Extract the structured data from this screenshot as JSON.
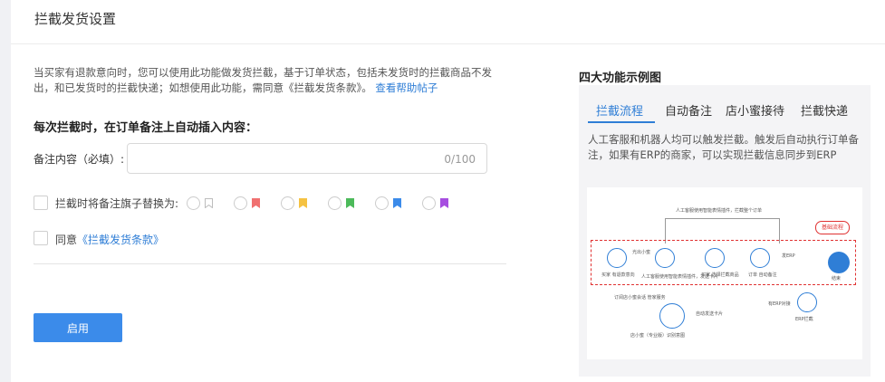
{
  "page_title": "拦截发货设置",
  "description": {
    "text": "当买家有退款意向时，您可以使用此功能做发货拦截，基于订单状态，包括未发货时的拦截商品不发出，和已发货时的拦截快递；如想使用此功能，需同意《拦截发货条款》。",
    "help_link": "查看帮助帖子"
  },
  "section_title": "每次拦截时，在订单备注上自动插入内容：",
  "remark_field": {
    "label": "备注内容（必填）:",
    "value": "",
    "placeholder": "",
    "counter": "0/100"
  },
  "flag_option": {
    "label": "拦截时将备注旗子替换为:",
    "flags": [
      {
        "name": "gray-flag",
        "color": "#c0c0c0"
      },
      {
        "name": "red-flag",
        "color": "#f07070"
      },
      {
        "name": "yellow-flag",
        "color": "#f5c242"
      },
      {
        "name": "green-flag",
        "color": "#4cba5a"
      },
      {
        "name": "blue-flag",
        "color": "#3b8bea"
      },
      {
        "name": "purple-flag",
        "color": "#a64ee0"
      }
    ]
  },
  "agree": {
    "label": "同意",
    "link": "《拦截发货条款》"
  },
  "enable_button": "启用",
  "colors": {
    "accent": "#3b8bea",
    "link": "#2f7ed6",
    "alert": "#e03232"
  },
  "sidebar": {
    "title": "四大功能示例图",
    "tabs": [
      "拦截流程",
      "自动备注",
      "店小蜜接待",
      "拦截快递"
    ],
    "active_tab": 0,
    "description": "人工客服和机器人均可以触发拦截。触发后自动执行订单备注，如果有ERP的商家，可以实现拦截信息同步到ERP"
  },
  "diagram": {
    "tag": "基础流程",
    "top_note": "人工客服使用智能表情插件，拦截整个订单",
    "tooltip": "光出小蜜",
    "nodes": [
      {
        "label": "买家\n有退款意向"
      },
      {
        "label": "人工客服使用智能表情插件，发送卡片"
      },
      {
        "label": "买家\n选择拦截商品"
      },
      {
        "label": "订单\n自动备注"
      },
      {
        "label": "结束"
      }
    ],
    "erp_sync": "发ERP",
    "has_erp": "有ERP对接",
    "erp_node": "ERP拦截",
    "bot_note": "订阅店小蜜会话\n管家服务",
    "bot_label": "店小蜜（专业版）识别意图",
    "auto_card": "自动发送卡片"
  }
}
